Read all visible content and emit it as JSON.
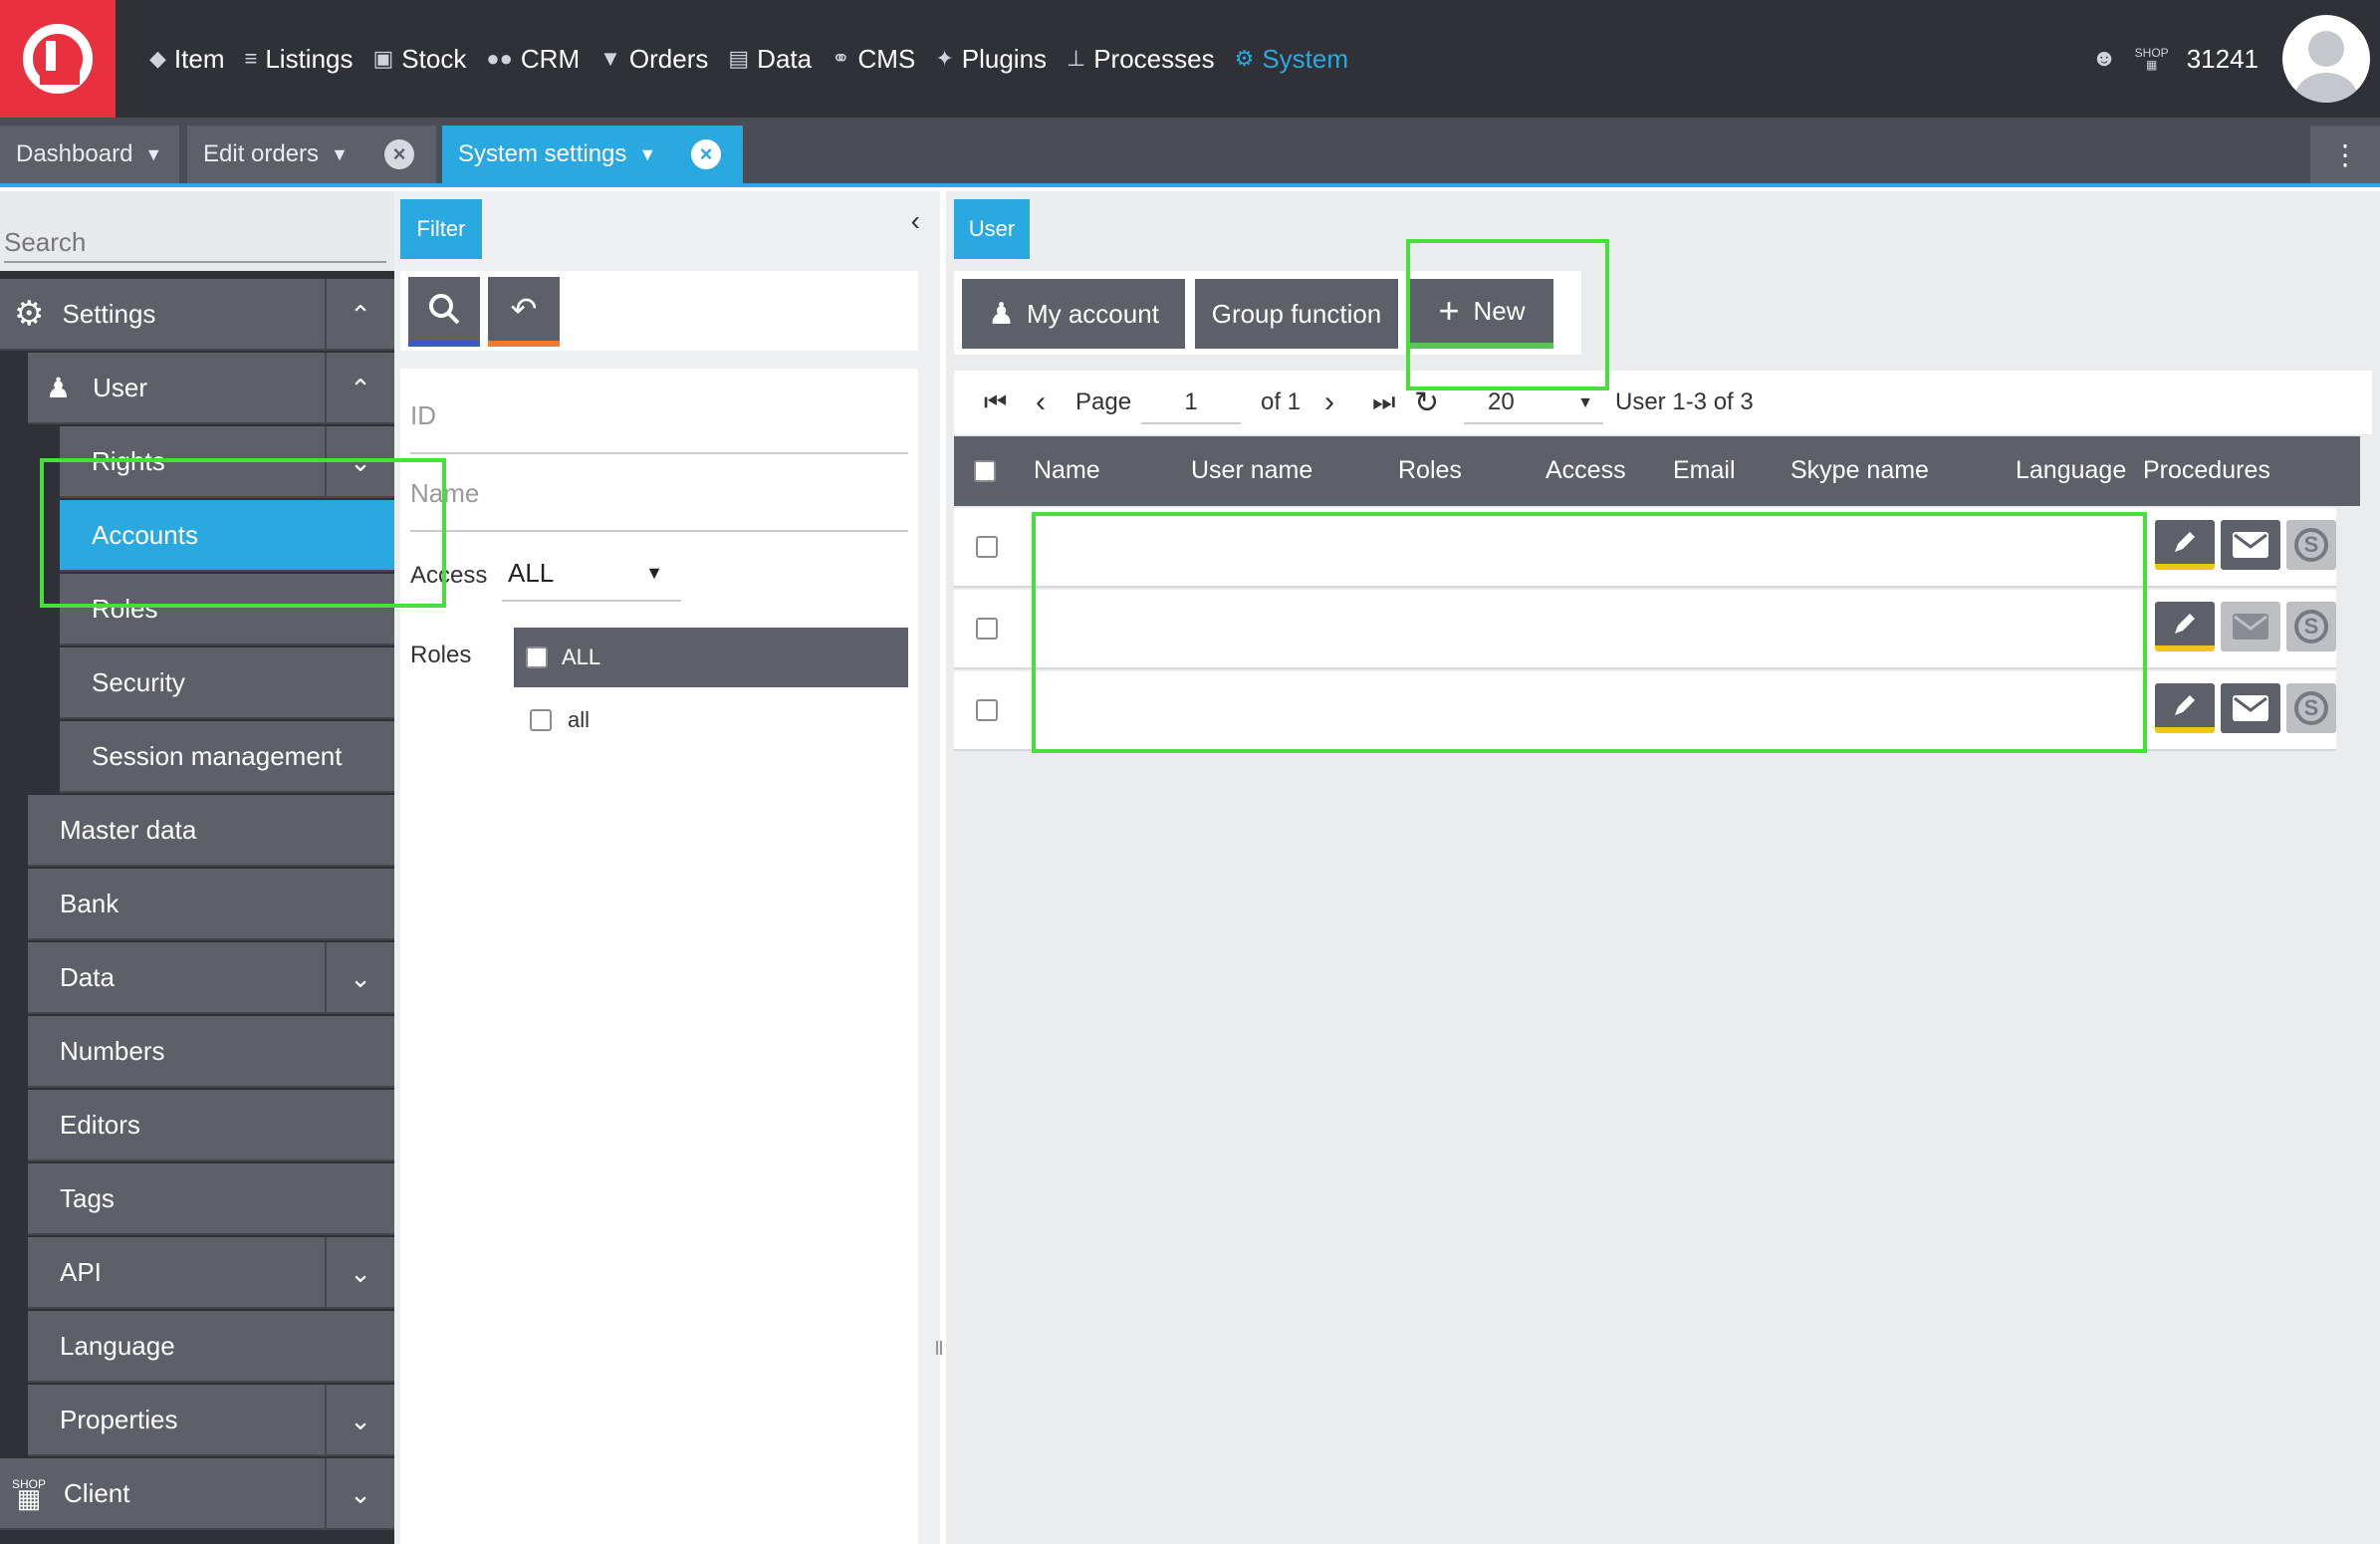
{
  "nav": {
    "items": [
      {
        "label": "Item",
        "icon": "tag-icon"
      },
      {
        "label": "Listings",
        "icon": "listings-icon"
      },
      {
        "label": "Stock",
        "icon": "boxes-icon"
      },
      {
        "label": "CRM",
        "icon": "people-icon"
      },
      {
        "label": "Orders",
        "icon": "cart-icon"
      },
      {
        "label": "Data",
        "icon": "database-icon"
      },
      {
        "label": "CMS",
        "icon": "globe-icon"
      },
      {
        "label": "Plugins",
        "icon": "puzzle-icon"
      },
      {
        "label": "Processes",
        "icon": "processes-icon"
      },
      {
        "label": "System",
        "icon": "gear-icon"
      }
    ],
    "shop_label": "SHOP",
    "shop_id": "31241"
  },
  "tabs": {
    "dashboard": "Dashboard",
    "edit_orders": "Edit orders",
    "system_settings": "System settings"
  },
  "sidebar": {
    "search_placeholder": "Search",
    "settings": "Settings",
    "user": "User",
    "rights": "Rights",
    "accounts": "Accounts",
    "roles": "Roles",
    "security": "Security",
    "session_management": "Session management",
    "master_data": "Master data",
    "bank": "Bank",
    "data": "Data",
    "numbers": "Numbers",
    "editors": "Editors",
    "tags": "Tags",
    "api": "API",
    "language": "Language",
    "properties": "Properties",
    "client_shop_label": "SHOP",
    "client": "Client"
  },
  "filter": {
    "tab_label": "Filter",
    "id_placeholder": "ID",
    "name_placeholder": "Name",
    "access_label": "Access",
    "access_value": "ALL",
    "roles_label": "Roles",
    "roles_all": "ALL",
    "roles_item": "all"
  },
  "content": {
    "tab_label": "User",
    "my_account": "My account",
    "group_function": "Group function",
    "new": "New",
    "pager": {
      "page_label": "Page",
      "page_value": "1",
      "of_label": "of 1",
      "per_page": "20",
      "summary": "User  1-3 of 3"
    },
    "columns": [
      "Name",
      "User name",
      "Roles",
      "Access",
      "Email",
      "Skype name",
      "Language",
      "Procedures"
    ]
  },
  "colors": {
    "accent": "#2aa9e0",
    "brand": "#e8303e",
    "highlight": "#47e03a"
  }
}
